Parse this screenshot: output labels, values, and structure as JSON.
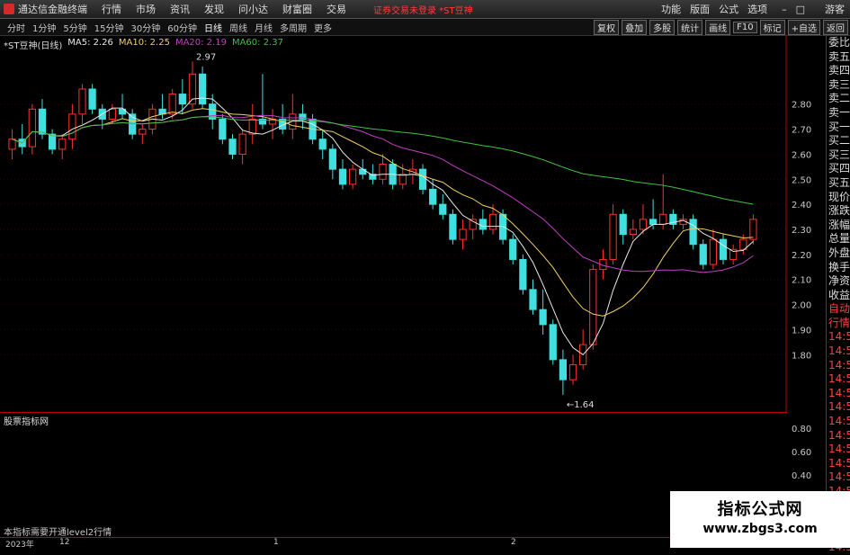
{
  "menubar": {
    "app_name": "通达信金融终端",
    "items": [
      "行情",
      "市场",
      "资讯",
      "发现",
      "问小达",
      "财富圈",
      "交易"
    ],
    "alert": "证券交易未登录 *ST豆神",
    "right_items": [
      "功能",
      "版面",
      "公式",
      "选项"
    ],
    "guest": "游客"
  },
  "toolbar": {
    "periods": [
      "分时",
      "1分钟",
      "5分钟",
      "15分钟",
      "30分钟",
      "60分钟",
      "日线",
      "周线",
      "月线",
      "多周期",
      "更多"
    ],
    "active_period": "日线",
    "right_buttons": [
      "复权",
      "叠加",
      "多股",
      "统计",
      "画线",
      "F10",
      "标记",
      "+自选",
      "返回"
    ]
  },
  "stock": {
    "title": "*ST豆神(日线)",
    "ma_labels": [
      "MA5: 2.26",
      "MA10: 2.25",
      "MA20: 2.19",
      "MA60: 2.37"
    ],
    "ma_colors": [
      "#e8e8e8",
      "#f0d060",
      "#c040c0",
      "#40c040"
    ],
    "high_marker": "2.97",
    "low_marker": "1.64"
  },
  "price_axis": [
    "2.80",
    "2.70",
    "2.60",
    "2.50",
    "2.40",
    "2.30",
    "2.20",
    "2.10",
    "2.00",
    "1.90",
    "1.80"
  ],
  "sidebar": {
    "items": [
      "委比",
      "卖五",
      "卖四",
      "卖三",
      "卖二",
      "卖一",
      "买一",
      "买二",
      "买三",
      "买四",
      "买五",
      "现价",
      "涨跌",
      "涨幅",
      "总量",
      "外盘",
      "换手",
      "净资",
      "收益",
      "自动",
      "行情",
      "14:5",
      "14:5",
      "14:5",
      "14:5",
      "14:5",
      "14:5",
      "14:5",
      "14:5",
      "14:5",
      "14:5",
      "14:5",
      "14:5",
      "14:5",
      "14:5",
      "14:5",
      "14:5"
    ]
  },
  "sub_panel": {
    "title": "股票指标网",
    "note": "本指标需要开通level2行情",
    "axis": [
      "0.80",
      "0.60",
      "0.40",
      "0.20",
      "0.00"
    ]
  },
  "datebar": {
    "labels": [
      "2023年",
      "12",
      "1",
      "2"
    ]
  },
  "watermark": {
    "line1": "指标公式网",
    "line2": "www.zbgs3.com"
  },
  "chart_data": {
    "type": "candlestick",
    "ylim": [
      1.6,
      3.0
    ],
    "candles": [
      [
        2.62,
        2.7,
        2.58,
        2.66
      ],
      [
        2.66,
        2.72,
        2.6,
        2.63
      ],
      [
        2.63,
        2.8,
        2.6,
        2.78
      ],
      [
        2.78,
        2.82,
        2.66,
        2.68
      ],
      [
        2.68,
        2.7,
        2.6,
        2.62
      ],
      [
        2.62,
        2.68,
        2.58,
        2.66
      ],
      [
        2.66,
        2.8,
        2.62,
        2.76
      ],
      [
        2.76,
        2.88,
        2.72,
        2.86
      ],
      [
        2.86,
        2.88,
        2.76,
        2.78
      ],
      [
        2.78,
        2.8,
        2.7,
        2.74
      ],
      [
        2.74,
        2.8,
        2.72,
        2.78
      ],
      [
        2.78,
        2.84,
        2.74,
        2.76
      ],
      [
        2.76,
        2.78,
        2.66,
        2.68
      ],
      [
        2.68,
        2.72,
        2.64,
        2.7
      ],
      [
        2.7,
        2.8,
        2.68,
        2.78
      ],
      [
        2.78,
        2.84,
        2.74,
        2.76
      ],
      [
        2.76,
        2.86,
        2.74,
        2.84
      ],
      [
        2.84,
        2.9,
        2.76,
        2.8
      ],
      [
        2.8,
        2.97,
        2.78,
        2.92
      ],
      [
        2.92,
        2.95,
        2.78,
        2.8
      ],
      [
        2.8,
        2.84,
        2.7,
        2.74
      ],
      [
        2.74,
        2.76,
        2.64,
        2.66
      ],
      [
        2.66,
        2.68,
        2.58,
        2.6
      ],
      [
        2.6,
        2.7,
        2.56,
        2.68
      ],
      [
        2.68,
        2.8,
        2.64,
        2.74
      ],
      [
        2.74,
        2.92,
        2.7,
        2.72
      ],
      [
        2.72,
        2.78,
        2.66,
        2.74
      ],
      [
        2.74,
        2.8,
        2.68,
        2.7
      ],
      [
        2.7,
        2.84,
        2.66,
        2.76
      ],
      [
        2.76,
        2.8,
        2.7,
        2.74
      ],
      [
        2.74,
        2.76,
        2.64,
        2.66
      ],
      [
        2.66,
        2.7,
        2.58,
        2.62
      ],
      [
        2.62,
        2.64,
        2.5,
        2.54
      ],
      [
        2.54,
        2.58,
        2.46,
        2.48
      ],
      [
        2.48,
        2.56,
        2.46,
        2.54
      ],
      [
        2.54,
        2.58,
        2.5,
        2.52
      ],
      [
        2.52,
        2.56,
        2.48,
        2.5
      ],
      [
        2.5,
        2.6,
        2.48,
        2.56
      ],
      [
        2.56,
        2.58,
        2.46,
        2.48
      ],
      [
        2.48,
        2.56,
        2.46,
        2.52
      ],
      [
        2.52,
        2.58,
        2.48,
        2.54
      ],
      [
        2.54,
        2.56,
        2.44,
        2.46
      ],
      [
        2.46,
        2.5,
        2.38,
        2.4
      ],
      [
        2.4,
        2.44,
        2.34,
        2.36
      ],
      [
        2.36,
        2.38,
        2.24,
        2.26
      ],
      [
        2.26,
        2.34,
        2.22,
        2.3
      ],
      [
        2.3,
        2.36,
        2.26,
        2.34
      ],
      [
        2.34,
        2.38,
        2.28,
        2.3
      ],
      [
        2.3,
        2.4,
        2.28,
        2.36
      ],
      [
        2.36,
        2.38,
        2.24,
        2.26
      ],
      [
        2.26,
        2.28,
        2.16,
        2.18
      ],
      [
        2.18,
        2.2,
        2.04,
        2.06
      ],
      [
        2.06,
        2.1,
        1.96,
        1.98
      ],
      [
        1.98,
        2.06,
        1.88,
        1.92
      ],
      [
        1.92,
        1.94,
        1.76,
        1.78
      ],
      [
        1.78,
        1.82,
        1.64,
        1.7
      ],
      [
        1.7,
        1.8,
        1.68,
        1.76
      ],
      [
        1.76,
        1.9,
        1.74,
        1.84
      ],
      [
        1.84,
        2.16,
        1.82,
        2.14
      ],
      [
        2.14,
        2.22,
        2.1,
        2.18
      ],
      [
        2.18,
        2.4,
        2.16,
        2.36
      ],
      [
        2.36,
        2.38,
        2.24,
        2.28
      ],
      [
        2.28,
        2.34,
        2.26,
        2.3
      ],
      [
        2.3,
        2.4,
        2.28,
        2.34
      ],
      [
        2.34,
        2.42,
        2.3,
        2.32
      ],
      [
        2.32,
        2.52,
        2.3,
        2.36
      ],
      [
        2.36,
        2.38,
        2.3,
        2.32
      ],
      [
        2.32,
        2.36,
        2.3,
        2.34
      ],
      [
        2.34,
        2.36,
        2.22,
        2.24
      ],
      [
        2.24,
        2.26,
        2.14,
        2.16
      ],
      [
        2.16,
        2.3,
        2.14,
        2.26
      ],
      [
        2.26,
        2.28,
        2.16,
        2.18
      ],
      [
        2.18,
        2.24,
        2.16,
        2.22
      ],
      [
        2.22,
        2.28,
        2.2,
        2.26
      ],
      [
        2.26,
        2.36,
        2.24,
        2.34
      ]
    ]
  }
}
